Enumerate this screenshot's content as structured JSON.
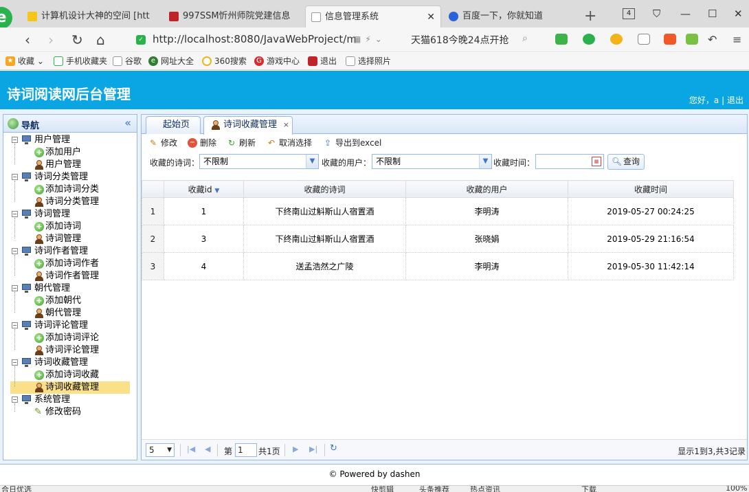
{
  "browser": {
    "tabs": [
      {
        "title": "计算机设计大神的空间 [htt",
        "active": false
      },
      {
        "title": "997SSM忻州师院党建信息",
        "active": false
      },
      {
        "title": "信息管理系统",
        "active": true
      },
      {
        "title": "百度一下，你就知道",
        "active": false
      }
    ],
    "tab_count": "4",
    "url": "http://localhost:8080/JavaWebProject/m",
    "promo": "天猫618今晚24点开抢",
    "bookmarks": [
      "收藏",
      "手机收藏夹",
      "谷歌",
      "网址大全",
      "360搜索",
      "游戏中心",
      "退出",
      "选择照片"
    ],
    "status_left": "合日优选 ",
    "status_right": [
      "快剪辑",
      "头条推荐",
      "热点资讯",
      "下载",
      "100%"
    ]
  },
  "app": {
    "title": "诗词阅读网后台管理",
    "greeting": "您好，a",
    "separator": "|",
    "logout": "退出"
  },
  "nav": {
    "title": "导航",
    "groups": [
      {
        "label": "用户管理",
        "children": [
          {
            "label": "添加用户",
            "icon": "add"
          },
          {
            "label": "用户管理",
            "icon": "user"
          }
        ]
      },
      {
        "label": "诗词分类管理",
        "children": [
          {
            "label": "添加诗词分类",
            "icon": "add"
          },
          {
            "label": "诗词分类管理",
            "icon": "user"
          }
        ]
      },
      {
        "label": "诗词管理",
        "children": [
          {
            "label": "添加诗词",
            "icon": "add"
          },
          {
            "label": "诗词管理",
            "icon": "user"
          }
        ]
      },
      {
        "label": "诗词作者管理",
        "children": [
          {
            "label": "添加诗词作者",
            "icon": "add"
          },
          {
            "label": "诗词作者管理",
            "icon": "user"
          }
        ]
      },
      {
        "label": "朝代管理",
        "children": [
          {
            "label": "添加朝代",
            "icon": "add"
          },
          {
            "label": "朝代管理",
            "icon": "user"
          }
        ]
      },
      {
        "label": "诗词评论管理",
        "children": [
          {
            "label": "添加诗词评论",
            "icon": "add"
          },
          {
            "label": "诗词评论管理",
            "icon": "user"
          }
        ]
      },
      {
        "label": "诗词收藏管理",
        "children": [
          {
            "label": "添加诗词收藏",
            "icon": "add"
          },
          {
            "label": "诗词收藏管理",
            "icon": "user",
            "selected": true
          }
        ]
      },
      {
        "label": "系统管理",
        "children": [
          {
            "label": "修改密码",
            "icon": "pen"
          }
        ]
      }
    ]
  },
  "content": {
    "tabs": [
      {
        "label": "起始页",
        "active": false
      },
      {
        "label": "诗词收藏管理",
        "active": true,
        "closable": true
      }
    ],
    "toolbar": {
      "edit": "修改",
      "delete": "删除",
      "refresh": "刷新",
      "unselect": "取消选择",
      "export": "导出到excel"
    },
    "filters": {
      "poem_label": "收藏的诗词：",
      "poem_value": "不限制",
      "user_label": "收藏的用户：",
      "user_value": "不限制",
      "time_label": "收藏时间：",
      "time_value": "",
      "query_button": "查询"
    },
    "table": {
      "columns": [
        "收藏id",
        "收藏的诗词",
        "收藏的用户",
        "收藏时间"
      ],
      "sort_indicator": "▼",
      "rows": [
        {
          "rownum": "1",
          "id": "1",
          "poem": "下终南山过斛斯山人宿置酒",
          "user": "李明涛",
          "time": "2019-05-27 00:24:25"
        },
        {
          "rownum": "2",
          "id": "3",
          "poem": "下终南山过斛斯山人宿置酒",
          "user": "张晓娟",
          "time": "2019-05-29 21:16:54"
        },
        {
          "rownum": "3",
          "id": "4",
          "poem": "送孟浩然之广陵",
          "user": "李明涛",
          "time": "2019-05-30 11:42:14"
        }
      ]
    },
    "pager": {
      "page_size": "5",
      "page_prefix": "第",
      "page_number": "1",
      "page_suffix": "共1页",
      "info": "显示1到3,共3记录"
    }
  },
  "footer": {
    "text": "© Powered by dashen"
  },
  "colors": {
    "header_bg": "#0aa6e3",
    "panel_border": "#95b8e7",
    "selected_bg": "#fbe08a"
  }
}
